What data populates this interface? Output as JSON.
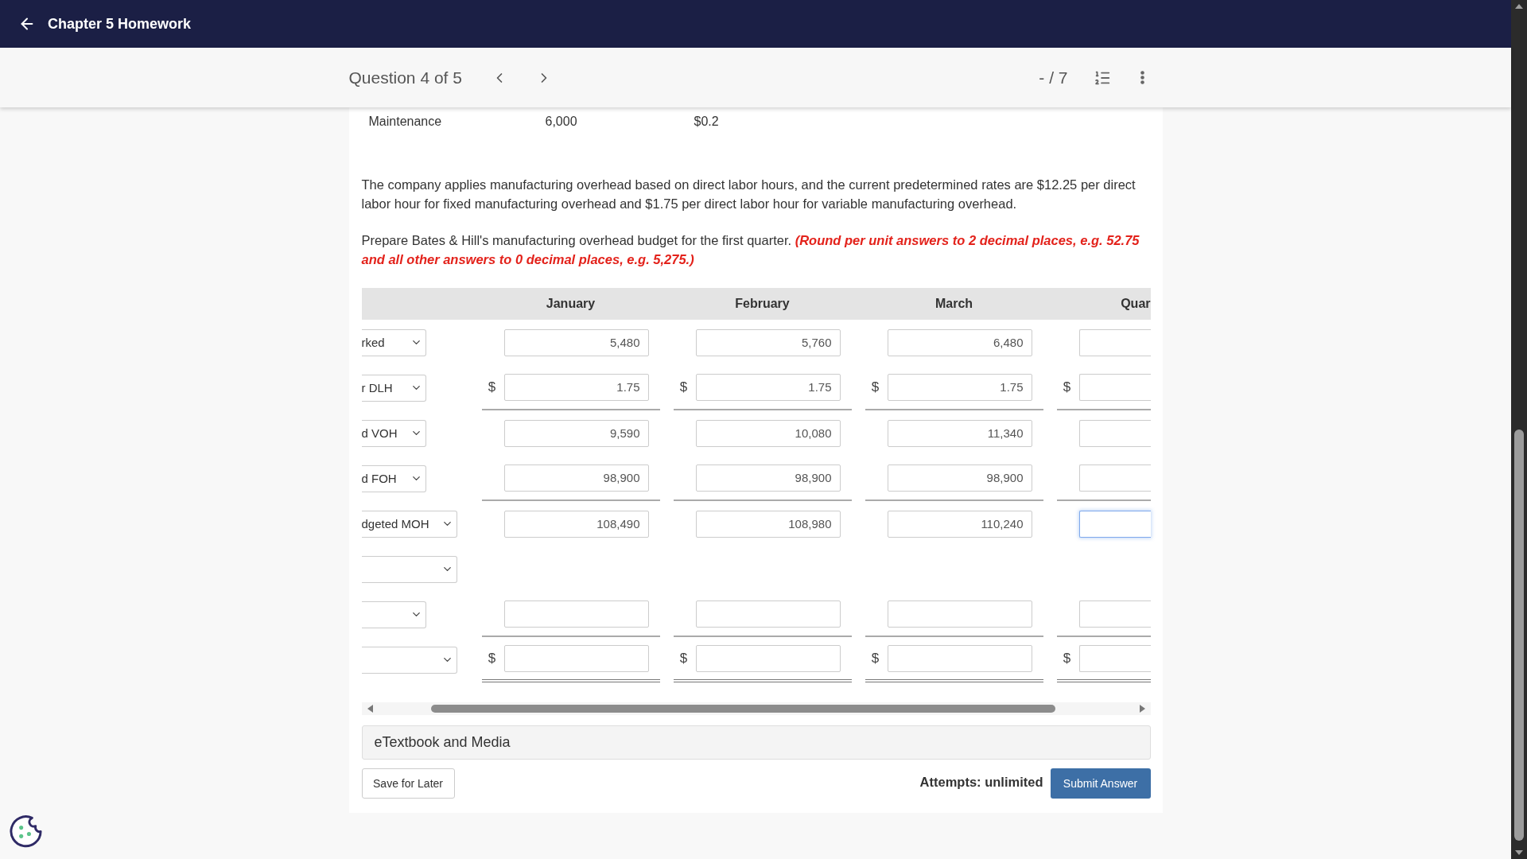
{
  "header": {
    "title": "Chapter 5 Homework"
  },
  "question_bar": {
    "title": "Question 4 of 5",
    "score": "- / 7"
  },
  "cost_table": {
    "rows": [
      [
        "Maintenance",
        "6,000",
        "$0.2"
      ]
    ]
  },
  "intro": "The company applies manufacturing overhead based on direct labor hours, and the current predetermined rates are $12.25 per direct labor hour for fixed manufacturing overhead and $1.75 per direct labor hour for variable manufacturing overhead.",
  "instruction": {
    "text": "Prepare Bates & Hill's manufacturing overhead budget for the first quarter.",
    "note": "(Round per unit answers to 2 decimal places, e.g. 52.75 and all other answers to 0 decimal places, e.g. 5,275.)"
  },
  "budget_table": {
    "columns": [
      "January",
      "February",
      "March",
      "Quar"
    ],
    "rows": [
      {
        "kind": "item",
        "select": "rked",
        "underlined": false,
        "double_underlined": false,
        "cells": [
          {
            "value": "5,480",
            "focused": false
          },
          {
            "value": "5,760",
            "focused": false
          },
          {
            "value": "6,480",
            "focused": false
          },
          {
            "focused": false
          }
        ]
      },
      {
        "kind": "item",
        "select": "r DLH",
        "underlined": true,
        "double_underlined": false,
        "cells": [
          {
            "prefix": "$",
            "value": "1.75",
            "focused": false
          },
          {
            "prefix": "$",
            "value": "1.75",
            "focused": false
          },
          {
            "prefix": "$",
            "value": "1.75",
            "focused": false
          },
          {
            "prefix": "$",
            "focused": false
          }
        ]
      },
      {
        "kind": "item",
        "select": "d VOH",
        "underlined": false,
        "double_underlined": false,
        "cells": [
          {
            "value": "9,590",
            "focused": false
          },
          {
            "value": "10,080",
            "focused": false
          },
          {
            "value": "11,340",
            "focused": false
          },
          {
            "focused": false
          }
        ]
      },
      {
        "kind": "item",
        "select": "d FOH",
        "underlined": true,
        "double_underlined": false,
        "cells": [
          {
            "value": "98,900",
            "focused": false
          },
          {
            "value": "98,900",
            "focused": false
          },
          {
            "value": "98,900",
            "focused": false
          },
          {
            "focused": false
          }
        ]
      },
      {
        "kind": "total",
        "select": "dgeted MOH",
        "underlined": false,
        "double_underlined": false,
        "cells": [
          {
            "value": "108,490",
            "focused": false
          },
          {
            "value": "108,980",
            "focused": false
          },
          {
            "value": "110,240",
            "focused": false
          },
          {
            "focused": true
          }
        ]
      },
      {
        "kind": "heading"
      },
      {
        "kind": "item",
        "underlined": true,
        "double_underlined": false,
        "cells": [
          {
            "focused": false
          },
          {
            "focused": false
          },
          {
            "focused": false
          },
          {
            "focused": false
          }
        ]
      },
      {
        "kind": "total",
        "underlined": false,
        "double_underlined": true,
        "cells": [
          {
            "prefix": "$",
            "focused": false
          },
          {
            "prefix": "$",
            "focused": false
          },
          {
            "prefix": "$",
            "focused": false
          },
          {
            "prefix": "$",
            "focused": false
          }
        ]
      }
    ]
  },
  "resources": {
    "label": "eTextbook and Media"
  },
  "footer": {
    "save_button": "Save for Later",
    "attempts": "Attempts: unlimited",
    "submit_button": "Submit Answer"
  }
}
